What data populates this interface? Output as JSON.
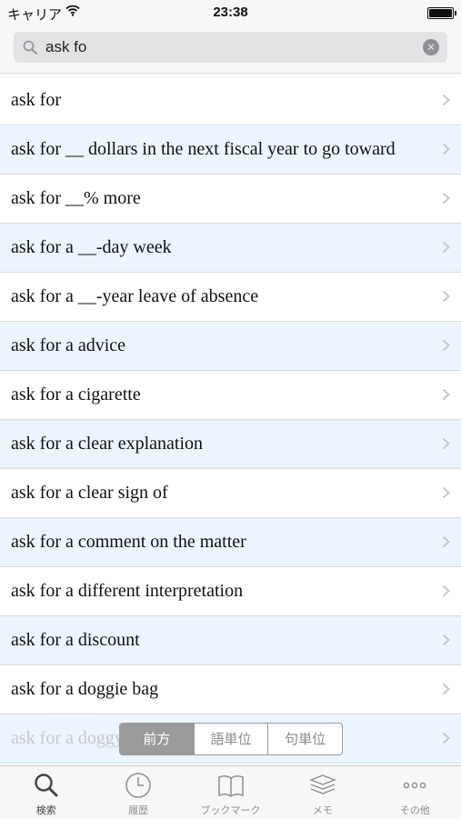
{
  "status_bar": {
    "carrier": "キャリア",
    "time": "23:38"
  },
  "search": {
    "query": "ask fo"
  },
  "results": [
    {
      "label": "ask for"
    },
    {
      "label": "ask for __ dollars in the next fiscal year to go toward"
    },
    {
      "label": "ask for __% more"
    },
    {
      "label": "ask for a __-day week"
    },
    {
      "label": "ask for a __-year leave of absence"
    },
    {
      "label": "ask for a advice"
    },
    {
      "label": "ask for a cigarette"
    },
    {
      "label": "ask for a clear explanation"
    },
    {
      "label": "ask for a clear sign of"
    },
    {
      "label": "ask for a comment on the matter"
    },
    {
      "label": "ask for a different interpretation"
    },
    {
      "label": "ask for a discount"
    },
    {
      "label": "ask for a doggie bag"
    },
    {
      "label": "ask for a doggy bag"
    }
  ],
  "segmented": {
    "options": [
      "前方",
      "語単位",
      "句単位"
    ],
    "selected": "前方"
  },
  "tab_bar": {
    "tabs": [
      {
        "label": "検索",
        "icon": "search-icon",
        "active": true
      },
      {
        "label": "履歴",
        "icon": "clock-icon",
        "active": false
      },
      {
        "label": "ブックマーク",
        "icon": "book-icon",
        "active": false
      },
      {
        "label": "メモ",
        "icon": "stack-icon",
        "active": false
      },
      {
        "label": "その他",
        "icon": "more-icon",
        "active": false
      }
    ]
  },
  "colors": {
    "row_alt": "#ecf4fd",
    "segment_active": "#9a9a9a"
  }
}
